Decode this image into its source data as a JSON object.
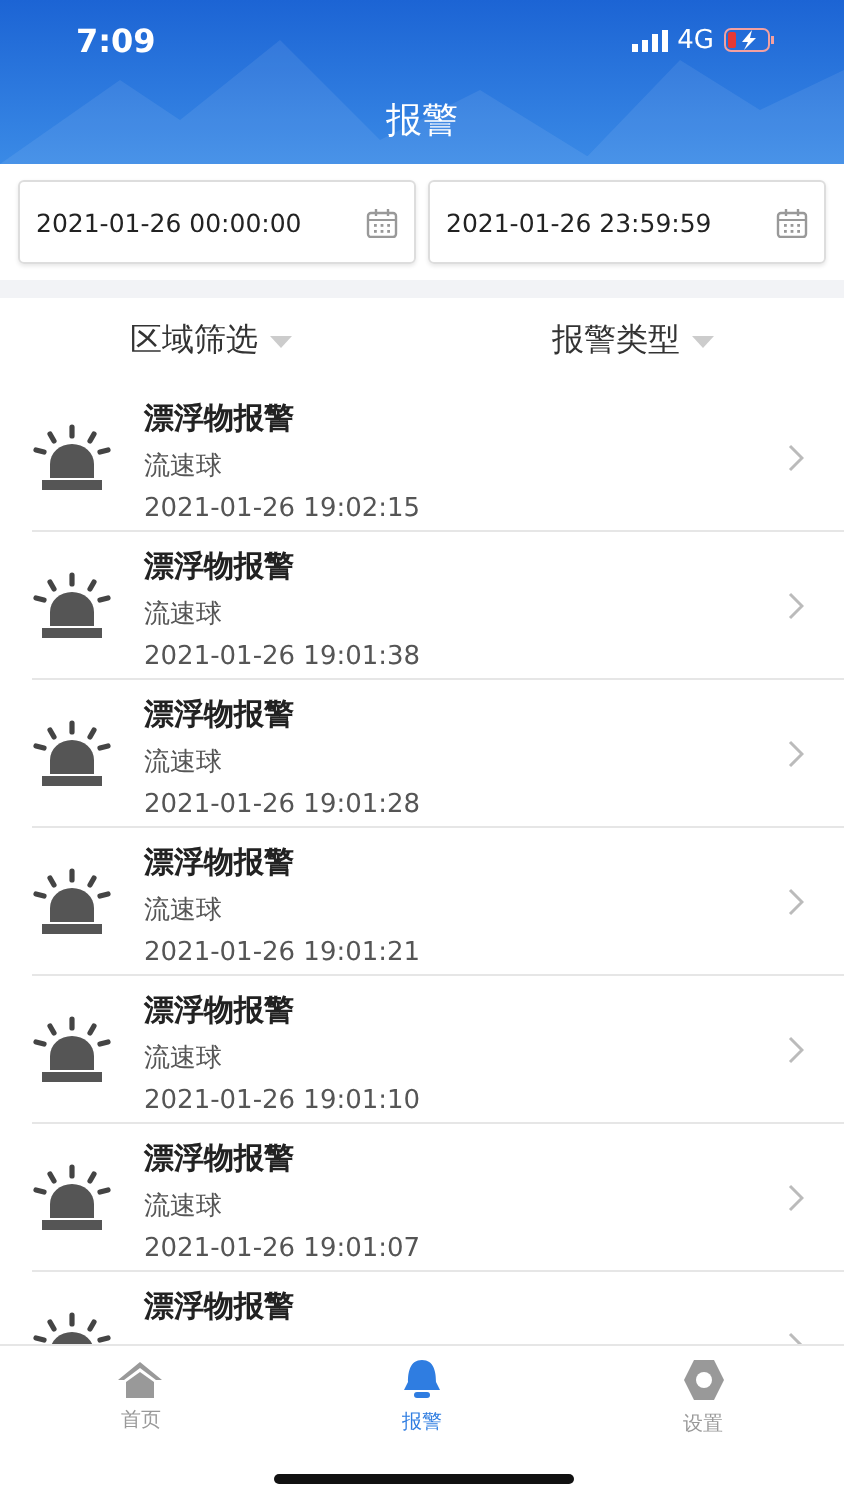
{
  "status_bar": {
    "time": "7:09",
    "network": "4G"
  },
  "header": {
    "title": "报警"
  },
  "date_range": [
    {
      "value": "2021-01-26 00:00:00"
    },
    {
      "value": "2021-01-26 23:59:59"
    }
  ],
  "filters": [
    {
      "label": "区域筛选"
    },
    {
      "label": "报警类型"
    }
  ],
  "alarms": [
    {
      "title": "漂浮物报警",
      "source": "流速球",
      "time": "2021-01-26 19:02:15"
    },
    {
      "title": "漂浮物报警",
      "source": "流速球",
      "time": "2021-01-26 19:01:38"
    },
    {
      "title": "漂浮物报警",
      "source": "流速球",
      "time": "2021-01-26 19:01:28"
    },
    {
      "title": "漂浮物报警",
      "source": "流速球",
      "time": "2021-01-26 19:01:21"
    },
    {
      "title": "漂浮物报警",
      "source": "流速球",
      "time": "2021-01-26 19:01:10"
    },
    {
      "title": "漂浮物报警",
      "source": "流速球",
      "time": "2021-01-26 19:01:07"
    },
    {
      "title": "漂浮物报警"
    }
  ],
  "tab_bar": [
    {
      "label": "首页",
      "kind": "home",
      "selected": false
    },
    {
      "label": "报警",
      "kind": "bell",
      "selected": true
    },
    {
      "label": "设置",
      "kind": "gear",
      "selected": false
    }
  ]
}
